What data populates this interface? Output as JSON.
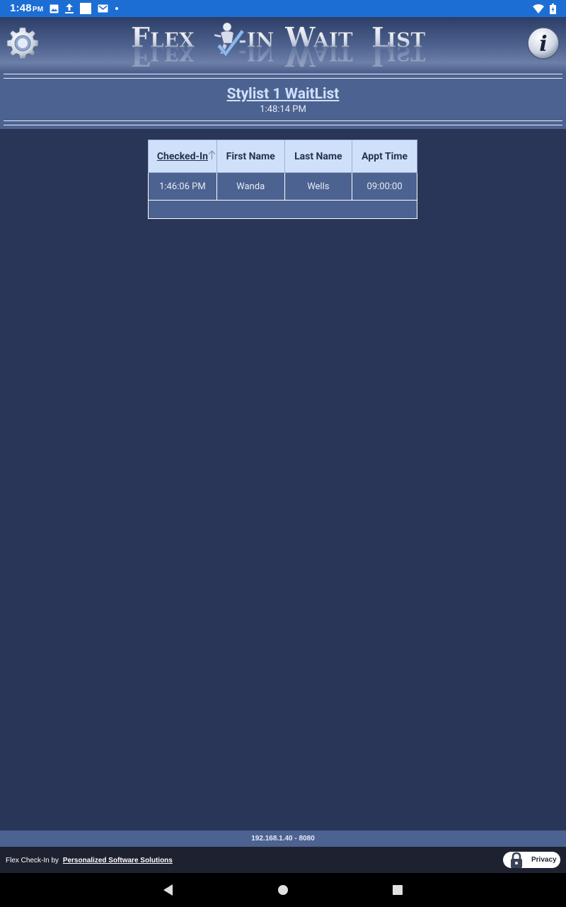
{
  "status_bar": {
    "time": "1:48",
    "ampm": "PM"
  },
  "header": {
    "logo_text": "FLEX✓-IN WAITLIST",
    "settings_icon": "gear-icon",
    "info_icon": "info-icon"
  },
  "title": {
    "heading": "Stylist 1 WaitList",
    "time": "1:48:14 PM"
  },
  "table": {
    "columns": [
      "Checked-In",
      "First Name",
      "Last Name",
      "Appt Time"
    ],
    "sorted_column": "Checked-In",
    "rows": [
      [
        "1:46:06 PM",
        "Wanda",
        "Wells",
        "09:00:00"
      ]
    ]
  },
  "ip_bar": {
    "text": "192.168.1.40 - 8080"
  },
  "footer": {
    "prefix": "Flex Check-In by",
    "link": "Personalized Software Solutions",
    "privacy_label": "Privacy"
  },
  "colors": {
    "background": "#293657",
    "band": "#4c6290",
    "header_cell": "#cfe0fb",
    "status_bar": "#1c6ed4"
  }
}
